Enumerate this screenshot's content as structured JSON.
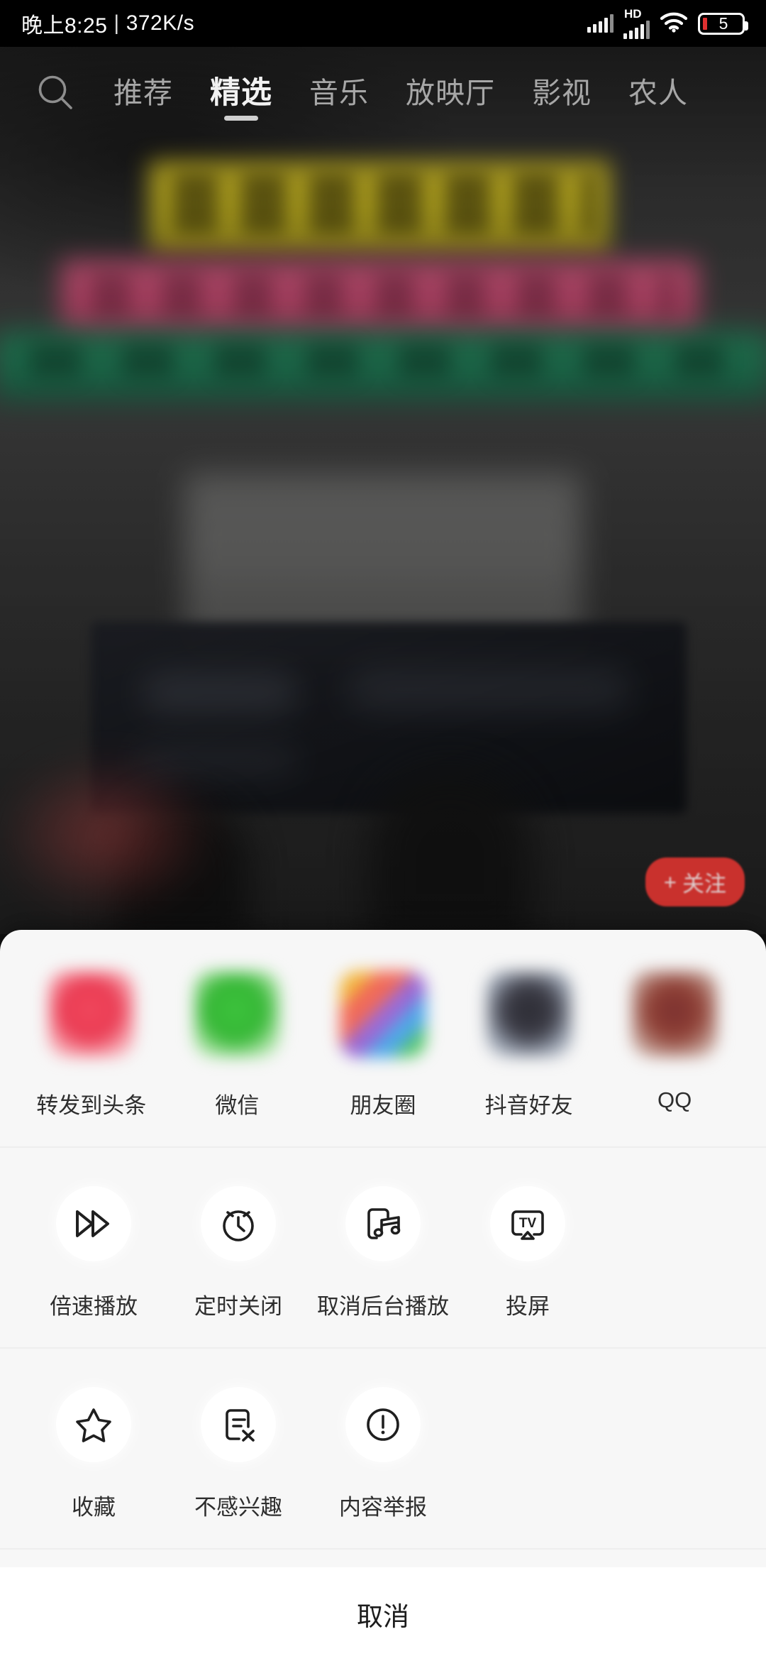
{
  "status_bar": {
    "time": "晚上8:25",
    "separator": "|",
    "network_speed": "372K/s",
    "hd_label": "HD",
    "battery_level": "5"
  },
  "top_nav": {
    "search_icon": "search-icon",
    "tabs": [
      {
        "label": "推荐",
        "active": false
      },
      {
        "label": "精选",
        "active": true
      },
      {
        "label": "音乐",
        "active": false
      },
      {
        "label": "放映厅",
        "active": false
      },
      {
        "label": "影视",
        "active": false
      },
      {
        "label": "农人",
        "active": false
      }
    ]
  },
  "video": {
    "follow_button": {
      "plus": "+",
      "label": "关注",
      "color": "#d8332f"
    }
  },
  "share_sheet": {
    "background": "#f7f7f7",
    "apps": [
      {
        "label": "转发到头条",
        "icon": "toutiao-icon",
        "color": "#ea3a52"
      },
      {
        "label": "微信",
        "icon": "wechat-icon",
        "color": "#34b634"
      },
      {
        "label": "朋友圈",
        "icon": "moments-icon",
        "color": "#f2b53a"
      },
      {
        "label": "抖音好友",
        "icon": "douyin-icon",
        "color": "#2b2b33"
      },
      {
        "label": "QQ",
        "icon": "qq-icon",
        "color": "#8f4035"
      }
    ],
    "actions_row1": [
      {
        "label": "倍速播放",
        "icon": "fast-forward-icon"
      },
      {
        "label": "定时关闭",
        "icon": "alarm-clock-icon"
      },
      {
        "label": "取消后台播放",
        "icon": "phone-music-icon"
      },
      {
        "label": "投屏",
        "icon": "tv-cast-icon"
      }
    ],
    "actions_row2": [
      {
        "label": "收藏",
        "icon": "star-icon"
      },
      {
        "label": "不感兴趣",
        "icon": "document-x-icon"
      },
      {
        "label": "内容举报",
        "icon": "exclamation-circle-icon"
      }
    ],
    "cancel_label": "取消"
  }
}
